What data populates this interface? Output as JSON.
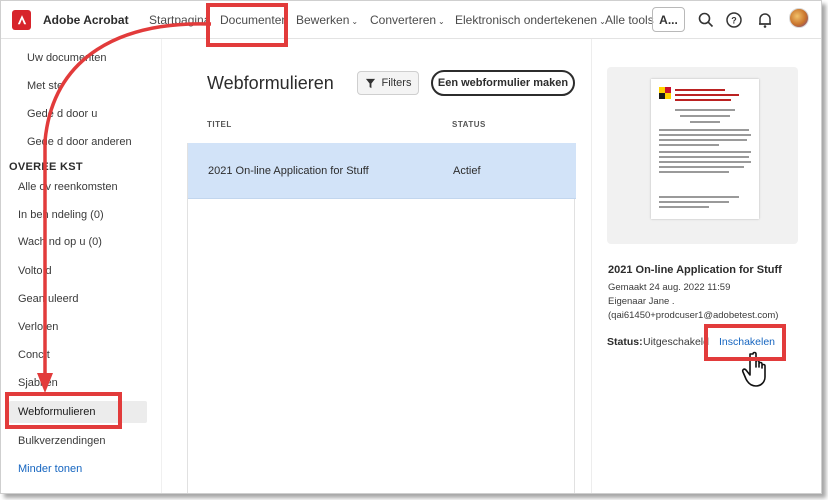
{
  "topbar": {
    "app_name": "Adobe Acrobat",
    "nav": [
      {
        "label": "Startpagina",
        "caret": false
      },
      {
        "label": "Documenten",
        "caret": false
      },
      {
        "label": "Bewerken",
        "caret": true
      },
      {
        "label": "Converteren",
        "caret": true
      },
      {
        "label": "Elektronisch ondertekenen",
        "caret": true
      },
      {
        "label": "Alle tools",
        "caret": false
      }
    ],
    "search_label": "A...",
    "icons": [
      "search-icon",
      "help-icon",
      "bell-icon",
      "avatar"
    ]
  },
  "sidebar": {
    "items_top": [
      "Uw documenten",
      "Met ste",
      "Gede d door u",
      "Gede d door anderen"
    ],
    "section_heading": "OVEREE KST",
    "items_agreements": [
      "Alle ov reenkomsten",
      "In beh ndeling (0)",
      "Wach nd op u (0)",
      "Volto d",
      "Gean uleerd",
      "Verlo en",
      "Conc t",
      "Sjabl en",
      "Webformulieren",
      "Bulkverzendingen"
    ],
    "active_item": "Webformulieren",
    "show_less": "Minder tonen"
  },
  "main": {
    "title": "Webformulieren",
    "filters_label": "Filters",
    "create_label": "Een webformulier maken",
    "columns": {
      "title": "TITEL",
      "status": "STATUS"
    },
    "rows": [
      {
        "title": "2021 On-line Application for Stuff",
        "status": "Actief"
      }
    ]
  },
  "details": {
    "title": "2021 On-line Application for Stuff",
    "created": "Gemaakt 24 aug. 2022 11:59",
    "owner": "Eigenaar Jane .",
    "email": "(qai61450+prodcuser1@adobetest.com)",
    "status_label": "Status:",
    "status_value": "Uitgeschakeld",
    "enable_label": "Inschakelen"
  },
  "colors": {
    "accent": "#1565c0",
    "selected_row": "#d2e3f8",
    "annotation": "#e23b3b",
    "adobe_red": "#d7242b"
  }
}
